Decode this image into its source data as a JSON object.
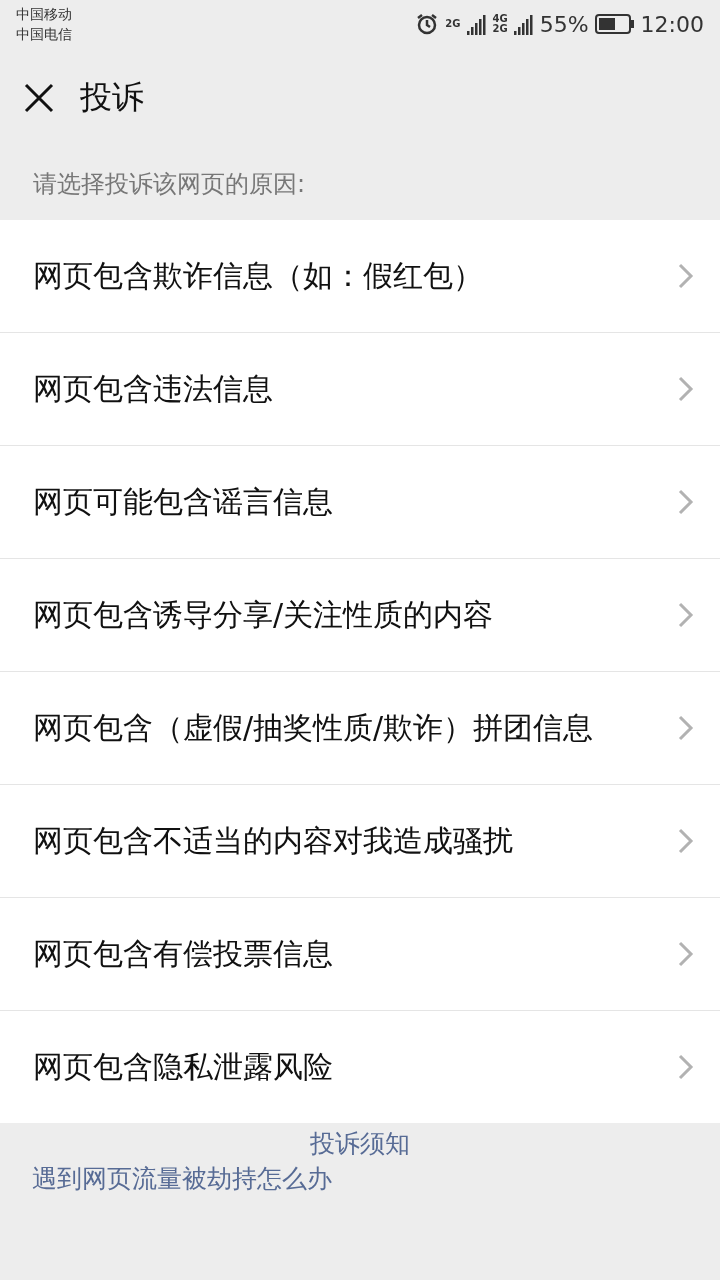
{
  "status_bar": {
    "carriers": [
      "中国移动",
      "中国电信"
    ],
    "networks": [
      "2G",
      "4G",
      "2G"
    ],
    "battery": "55%",
    "time": "12:00"
  },
  "header": {
    "title": "投诉"
  },
  "prompt": "请选择投诉该网页的原因:",
  "reasons": [
    {
      "label": "网页包含欺诈信息（如：假红包）"
    },
    {
      "label": "网页包含违法信息"
    },
    {
      "label": "网页可能包含谣言信息"
    },
    {
      "label": "网页包含诱导分享/关注性质的内容"
    },
    {
      "label": "网页包含（虚假/抽奖性质/欺诈）拼团信息"
    },
    {
      "label": "网页包含不适当的内容对我造成骚扰"
    },
    {
      "label": "网页包含有偿投票信息"
    },
    {
      "label": "网页包含隐私泄露风险"
    }
  ],
  "footer": {
    "notice_link": "投诉须知",
    "hijack_link": "遇到网页流量被劫持怎么办"
  }
}
